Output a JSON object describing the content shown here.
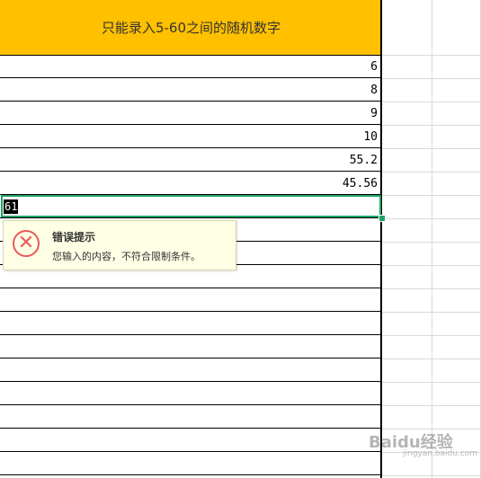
{
  "sheet": {
    "header": "只能录入5-60之间的随机数字",
    "values": [
      "6",
      "8",
      "9",
      "10",
      "55.2",
      "45.56"
    ],
    "editing_value": "61",
    "accent_color": "#ffc000",
    "selection_color": "#21a366"
  },
  "error_tooltip": {
    "icon": "error-x-icon",
    "title": "错误提示",
    "message": "您输入的内容，不符合限制条件。"
  },
  "watermark": {
    "brand": "Baidu经验",
    "url": "jingyan.baidu.com"
  }
}
